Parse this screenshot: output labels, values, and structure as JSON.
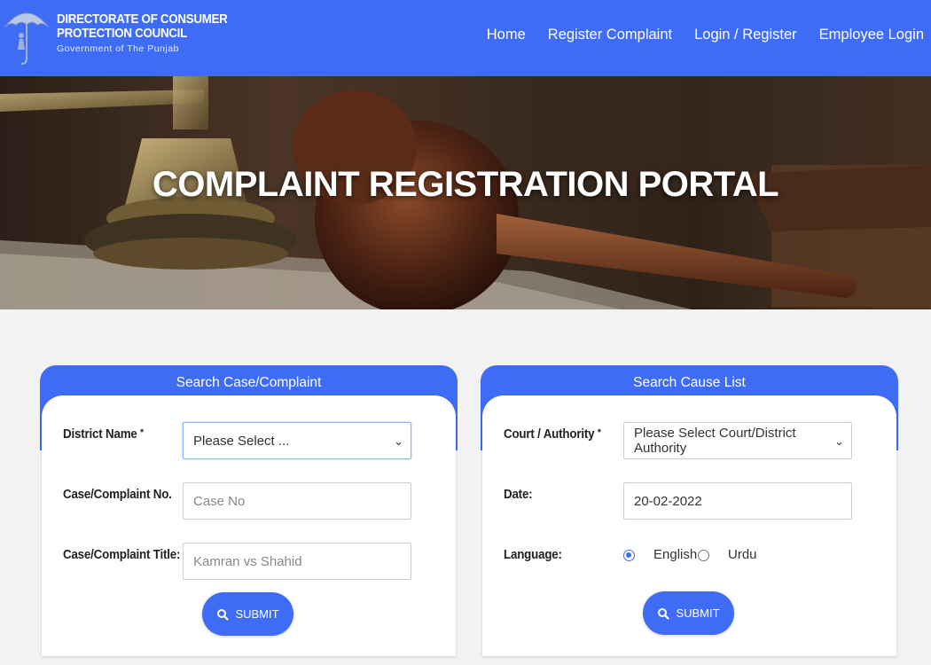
{
  "header": {
    "org_line1": "DIRECTORATE OF CONSUMER",
    "org_line2": "PROTECTION COUNCIL",
    "org_line3": "Government of The Punjab",
    "nav": [
      "Home",
      "Register Complaint",
      "Login / Register",
      "Employee Login"
    ],
    "accent_color": "#3f6cf5"
  },
  "hero": {
    "title": "COMPLAINT REGISTRATION PORTAL"
  },
  "search_case": {
    "title": "Search Case/Complaint",
    "district_label": "District Name",
    "required_mark": "*",
    "district_value": "Please Select ...",
    "case_no_label": "Case/Complaint No.",
    "case_no_placeholder": "Case No",
    "case_title_label": "Case/Complaint Title:",
    "case_title_placeholder": "Kamran vs Shahid",
    "submit_label": "SUBMIT"
  },
  "cause_list": {
    "title": "Search Cause List",
    "court_label": "Court / Authority",
    "required_mark": "*",
    "court_value": "Please Select Court/District Authority",
    "date_label": "Date:",
    "date_value": "20-02-2022",
    "language_label": "Language:",
    "language_options": [
      "English",
      "Urdu"
    ],
    "language_selected": "English",
    "submit_label": "SUBMIT"
  }
}
